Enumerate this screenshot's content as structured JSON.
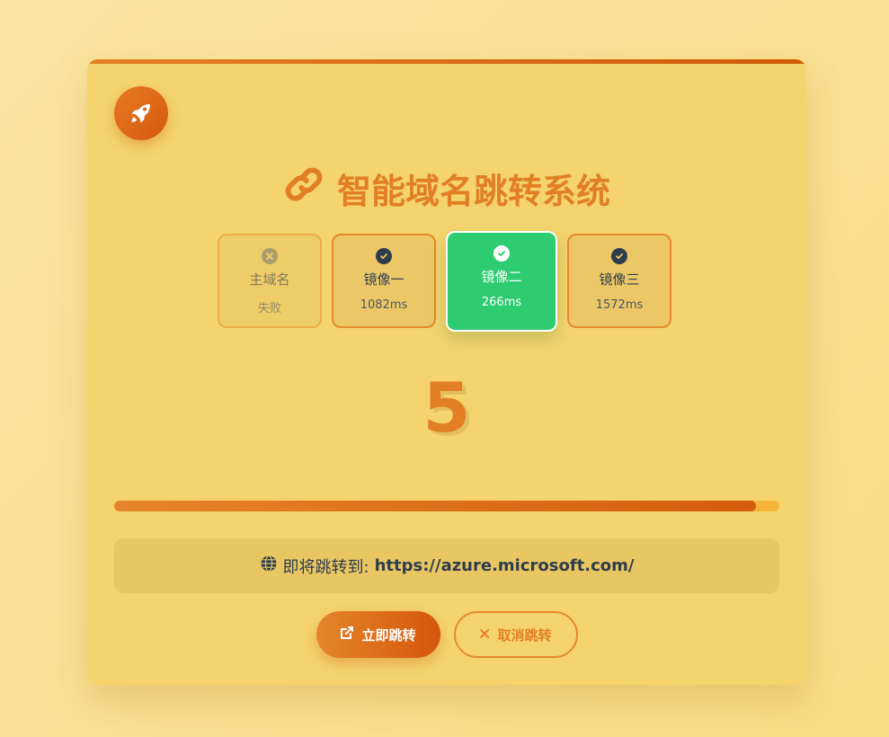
{
  "app": {
    "title": "智能域名跳转系统",
    "countdown": "5",
    "progress_percent": 96.5
  },
  "mirrors": [
    {
      "name": "主域名",
      "status": "失败",
      "state": "failed"
    },
    {
      "name": "镜像一",
      "status": "1082ms",
      "state": "ok"
    },
    {
      "name": "镜像二",
      "status": "266ms",
      "state": "selected"
    },
    {
      "name": "镜像三",
      "status": "1572ms",
      "state": "ok"
    }
  ],
  "redirect": {
    "label": "即将跳转到:",
    "url": "https://azure.microsoft.com/"
  },
  "actions": {
    "go_now": "立即跳转",
    "cancel": "取消跳转"
  },
  "icons": {
    "badge": "rocket-icon",
    "title": "link-icon",
    "redirect": "globe-icon",
    "go_now": "external-link-icon",
    "cancel": "close-icon"
  },
  "colors": {
    "accent": "#e27f25",
    "accent_dark": "#d4570a",
    "success": "#2ecc71",
    "card_bg": "#f5d46d",
    "text_dark": "#2f3c4c"
  }
}
